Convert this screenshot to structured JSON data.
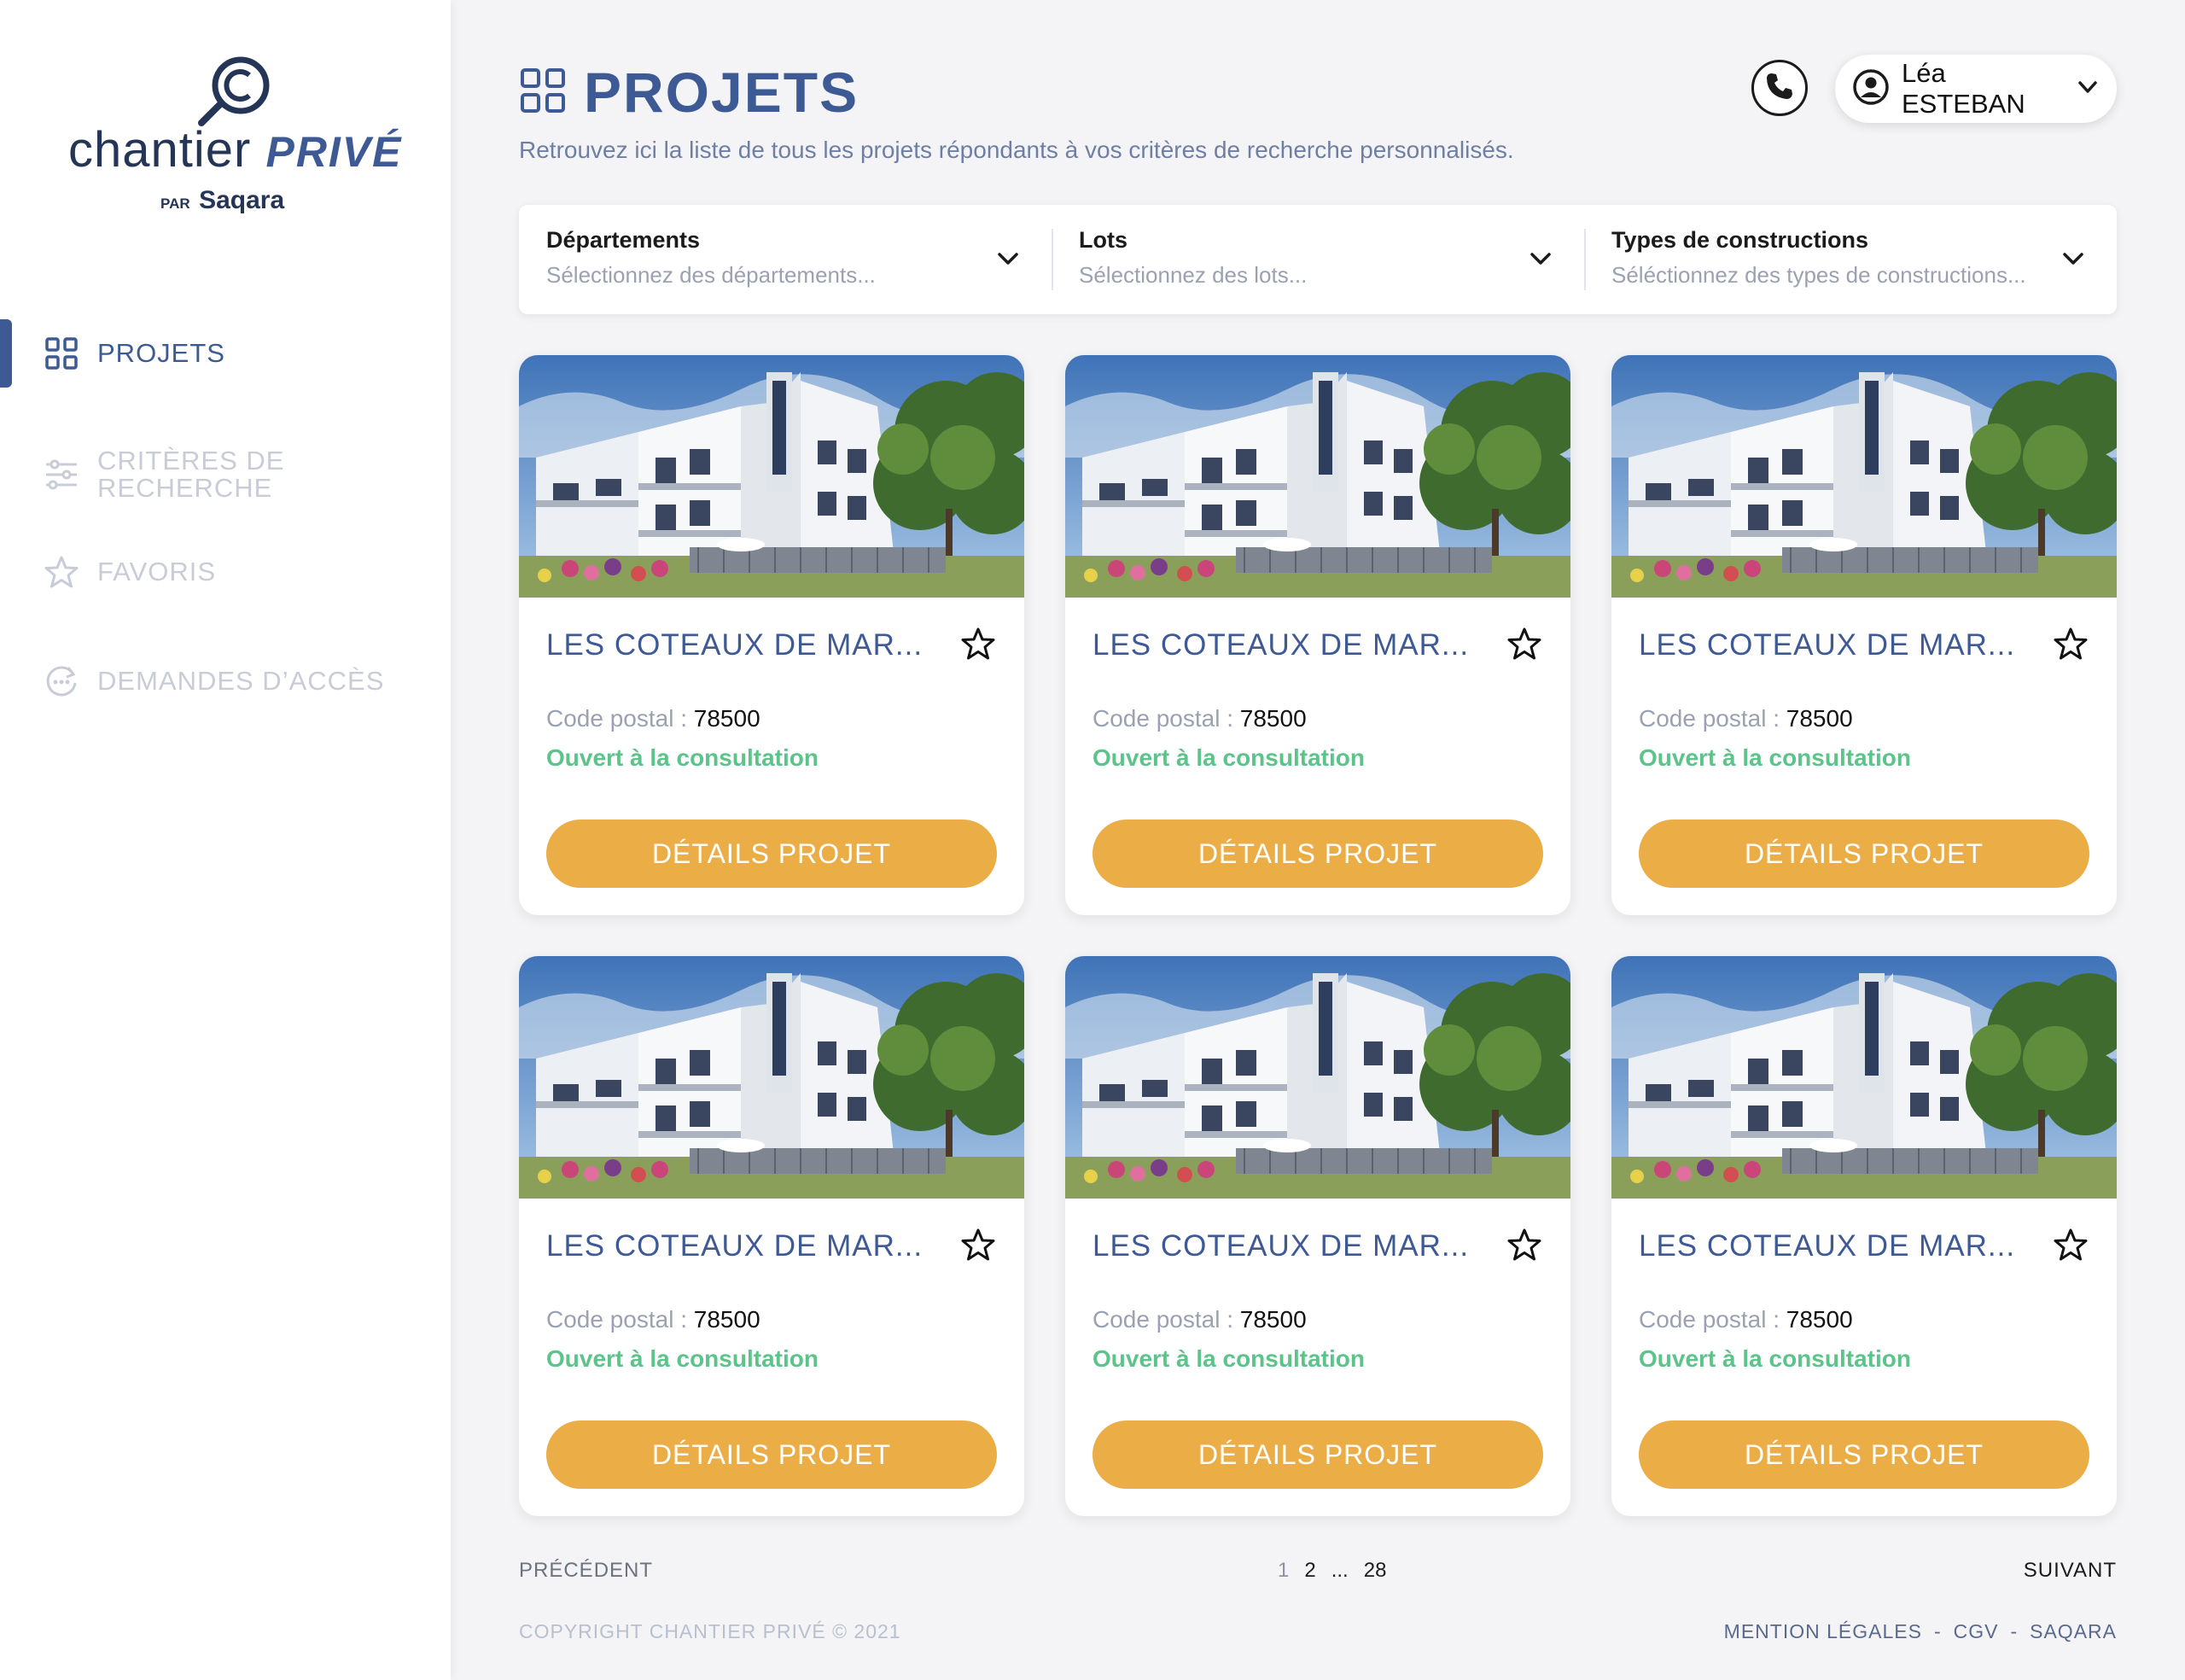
{
  "brand": {
    "name": "chantier",
    "name_accent": "PRIVÉ",
    "by": "PAR",
    "by_brand": "Saqara"
  },
  "sidebar": {
    "items": [
      {
        "label": "PROJETS",
        "icon": "grid-icon",
        "active": true
      },
      {
        "label": "CRITÈRES DE RECHERCHE",
        "icon": "sliders-icon",
        "active": false
      },
      {
        "label": "FAVORIS",
        "icon": "star-icon",
        "active": false
      },
      {
        "label": "DEMANDES D’ACCÈS",
        "icon": "access-request-icon",
        "active": false
      }
    ]
  },
  "header": {
    "title": "PROJETS",
    "description": "Retrouvez ici la liste de tous les projets répondants à vos critères de recherche personnalisés.",
    "user_name": "Léa ESTEBAN"
  },
  "filters": [
    {
      "label": "Départements",
      "placeholder": "Sélectionnez des départements..."
    },
    {
      "label": "Lots",
      "placeholder": "Sélectionnez des lots..."
    },
    {
      "label": "Types de constructions",
      "placeholder": "Séléctionnez des types de constructions..."
    }
  ],
  "cards": [
    {
      "title": "LES COTEAUX DE MAR...",
      "postal_label": "Code postal :",
      "postal": "78500",
      "status": "Ouvert à la consultation",
      "button": "DÉTAILS PROJET"
    },
    {
      "title": "LES COTEAUX DE MAR...",
      "postal_label": "Code postal :",
      "postal": "78500",
      "status": "Ouvert à la consultation",
      "button": "DÉTAILS PROJET"
    },
    {
      "title": "LES COTEAUX DE MAR...",
      "postal_label": "Code postal :",
      "postal": "78500",
      "status": "Ouvert à la consultation",
      "button": "DÉTAILS PROJET"
    },
    {
      "title": "LES COTEAUX DE MAR...",
      "postal_label": "Code postal :",
      "postal": "78500",
      "status": "Ouvert à la consultation",
      "button": "DÉTAILS PROJET"
    },
    {
      "title": "LES COTEAUX DE MAR...",
      "postal_label": "Code postal :",
      "postal": "78500",
      "status": "Ouvert à la consultation",
      "button": "DÉTAILS PROJET"
    },
    {
      "title": "LES COTEAUX DE MAR...",
      "postal_label": "Code postal :",
      "postal": "78500",
      "status": "Ouvert à la consultation",
      "button": "DÉTAILS PROJET"
    }
  ],
  "pagination": {
    "prev": "PRÉCÉDENT",
    "next": "SUIVANT",
    "pages": [
      "1",
      "2",
      "...",
      "28"
    ],
    "current": "1"
  },
  "footer": {
    "copyright": "COPYRIGHT CHANTIER PRIVÉ © 2021",
    "links": [
      "MENTION LÉGALES",
      "-",
      "CGV",
      "-",
      "SAQARA"
    ]
  },
  "colors": {
    "primary": "#3d5a94",
    "accent": "#ebad46",
    "status_open": "#5cc48a",
    "background": "#f4f4f6"
  }
}
